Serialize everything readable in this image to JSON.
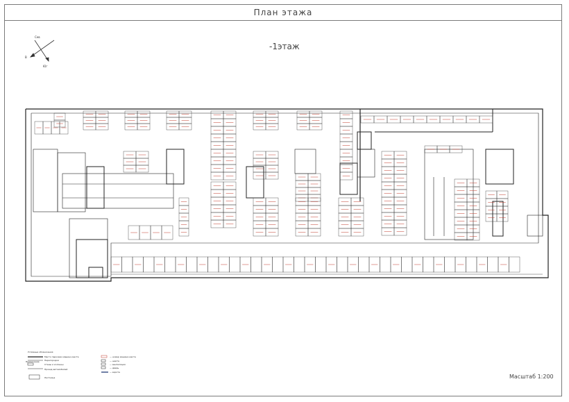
{
  "title": "План этажа",
  "floor": "-1этаж",
  "scale": "Масштаб 1:200",
  "compass": {
    "north": "Сев",
    "south": "Юг",
    "east": "В"
  },
  "legend": {
    "caption": "Условные обозначения",
    "side_note": "Примечание",
    "items": [
      "Место парковки машино-места",
      "Перегородки",
      "Стены и колонны",
      "Проезд автомобилей",
      "Лестница"
    ],
    "items_right": [
      "— номер машино-места",
      "— шахта",
      "— вентиляция",
      "— дверь",
      "— ворота"
    ]
  },
  "colors": {
    "line": "#333333",
    "wall": "#111111",
    "label": "#c0392b",
    "frame": "#7a7a7a"
  }
}
